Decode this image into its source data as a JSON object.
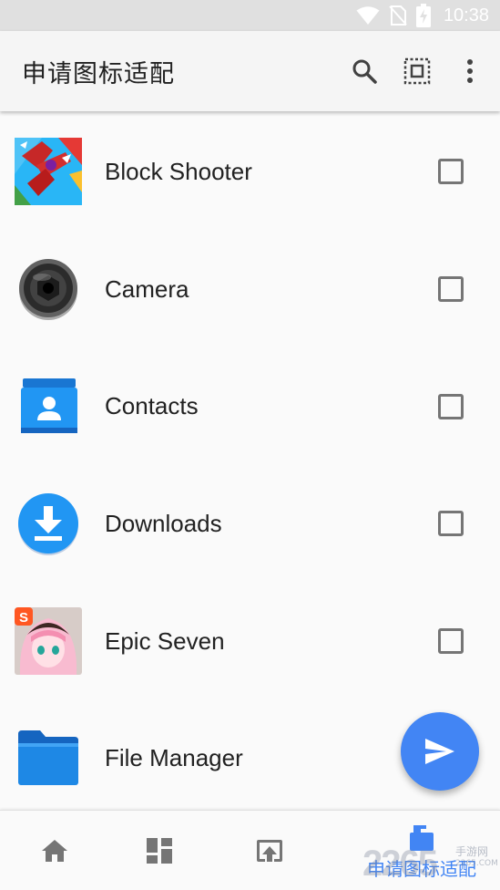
{
  "status_bar": {
    "time": "10:38",
    "icons": [
      "wifi-icon",
      "no-sim-icon",
      "battery-charging-icon"
    ]
  },
  "app_bar": {
    "title": "申请图标适配",
    "actions": [
      "search-icon",
      "select-all-icon",
      "more-vert-icon"
    ]
  },
  "apps": [
    {
      "name": "Block Shooter",
      "icon": "block-shooter-app-icon",
      "checked": false
    },
    {
      "name": "Camera",
      "icon": "camera-app-icon",
      "checked": false
    },
    {
      "name": "Contacts",
      "icon": "contacts-app-icon",
      "checked": false
    },
    {
      "name": "Downloads",
      "icon": "downloads-app-icon",
      "checked": false
    },
    {
      "name": "Epic Seven",
      "icon": "epic-seven-app-icon",
      "checked": false
    },
    {
      "name": "File Manager",
      "icon": "file-manager-app-icon",
      "checked": false
    }
  ],
  "fab": {
    "icon": "send-icon"
  },
  "bottom_nav": {
    "items": [
      {
        "icon": "home-icon"
      },
      {
        "icon": "dashboard-icon"
      },
      {
        "icon": "upload-icon"
      },
      {
        "icon": "icon-request-icon",
        "label": "申请图标适配",
        "active": true
      }
    ]
  },
  "watermark": {
    "text": "2265",
    "sub1": "手游网",
    "sub2": "2265.COM"
  },
  "colors": {
    "accent": "#4285f4",
    "app_bar_bg": "#f5f5f5",
    "status_bar_bg": "#e0e0e0",
    "text_primary": "#212121",
    "icon_grey": "#757575"
  }
}
